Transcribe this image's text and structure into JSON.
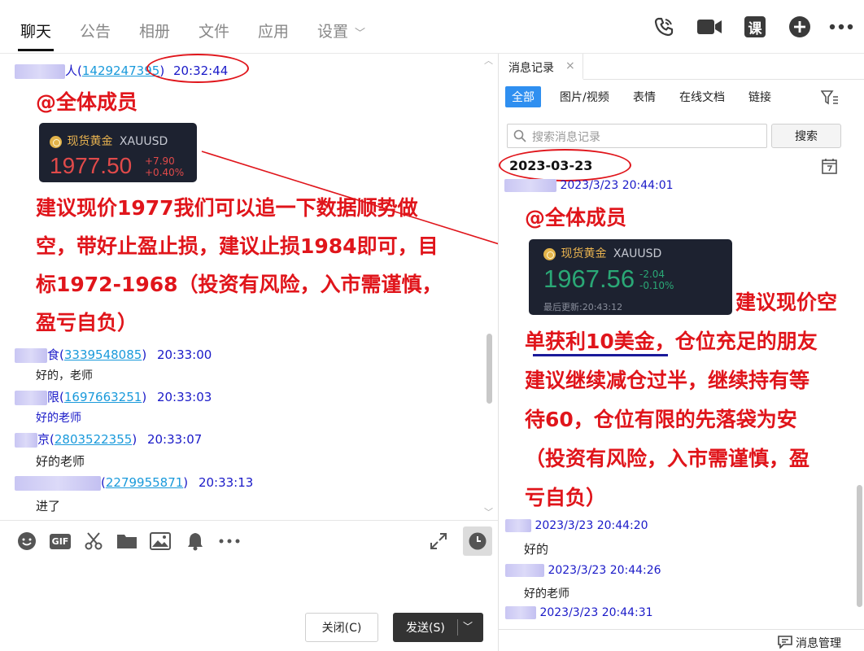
{
  "nav": {
    "tabs": [
      "聊天",
      "公告",
      "相册",
      "文件",
      "应用",
      "设置"
    ],
    "active": "聊天"
  },
  "chat": {
    "msg1": {
      "name_suffix": "人",
      "qq": "1429247395",
      "time": "20:32:44"
    },
    "at_all": "@全体成员",
    "quote1": {
      "name": "现货黄金",
      "symbol": "XAUUSD",
      "price": "1977.50",
      "change": "+7.90",
      "pct": "+0.40%"
    },
    "advice_lines": [
      "建议现价1977我们可以追一下数据顺势做",
      "空，带好止盈止损，建议止损1984即可，目",
      "标1972-1968（投资有风险，入市需谨慎，",
      "盈亏自负）"
    ],
    "replies": [
      {
        "name_suffix": "食",
        "qq": "3339548085",
        "time": "20:33:00",
        "text": "好的，老师"
      },
      {
        "name_suffix": "限",
        "qq": "1697663251",
        "time": "20:33:03",
        "text": "好的老师"
      },
      {
        "name_suffix": "京",
        "qq": "2803522355",
        "time": "20:33:07",
        "text": "好的老师"
      },
      {
        "name_suffix": "",
        "qq": "2279955871",
        "time": "20:33:13",
        "text": "进了"
      }
    ]
  },
  "compose": {
    "close_label": "关闭(C)",
    "send_label": "发送(S)"
  },
  "history": {
    "tab_label": "消息记录",
    "filters": [
      "全部",
      "图片/视频",
      "表情",
      "在线文档",
      "链接"
    ],
    "search_placeholder": "搜索消息记录",
    "search_button": "搜索",
    "date": "2023-03-23",
    "first_time": "2023/3/23 20:44:01",
    "at_all": "@全体成员",
    "quote2": {
      "name": "现货黄金",
      "symbol": "XAUUSD",
      "price": "1967.56",
      "change": "-2.04",
      "pct": "-0.10%",
      "updated": "最后更新:20:43:12"
    },
    "advice_head": "建议现价空",
    "advice_lines": [
      "单获利10美金，仓位充足的朋友",
      "建议继续减仓过半，继续持有等",
      "待60，仓位有限的先落袋为安",
      "（投资有风险，入市需谨慎，盈",
      "亏自负）"
    ],
    "replies": [
      {
        "time": "2023/3/23 20:44:20",
        "text": "好的"
      },
      {
        "time": "2023/3/23 20:44:26",
        "text": "好的老师"
      },
      {
        "time": "2023/3/23 20:44:31",
        "text": ""
      }
    ],
    "manage_label": "消息管理"
  }
}
